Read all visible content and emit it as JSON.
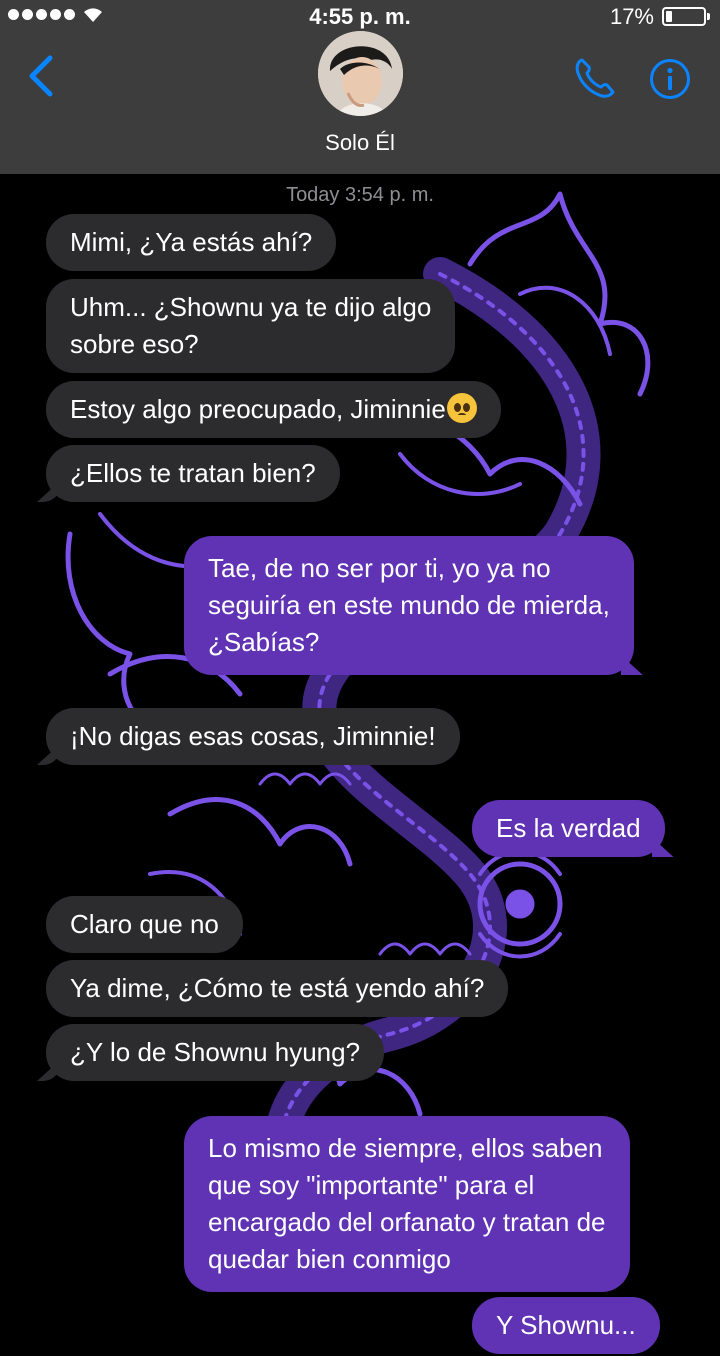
{
  "status_bar": {
    "time": "4:55 p. m.",
    "battery_percent": "17%",
    "battery_level": 0.17,
    "signal_dots": 5
  },
  "header": {
    "contact_name": "Solo Él",
    "back_icon": "chevron-left-icon",
    "call_icon": "phone-icon",
    "info_icon": "info-icon",
    "accent_color": "#0a84ff"
  },
  "conversation": {
    "timestamp": "Today 3:54 p. m.",
    "messages": [
      {
        "from": "them",
        "text": "Mimi, ¿Ya estás ahí?"
      },
      {
        "from": "them",
        "lines": [
          "Uhm... ¿Shownu ya te dijo algo",
          "sobre eso?"
        ]
      },
      {
        "from": "them",
        "text": "Estoy algo preocupado, Jiminnie",
        "emoji": "pleading-face-emoji"
      },
      {
        "from": "them",
        "text": "¿Ellos te tratan bien?"
      },
      {
        "from": "me",
        "lines": [
          "Tae, de no ser por ti, yo ya no",
          "seguiría en este mundo de mierda,",
          "¿Sabías?"
        ]
      },
      {
        "from": "them",
        "text": "¡No digas esas cosas, Jiminnie!"
      },
      {
        "from": "me",
        "text": "Es la verdad"
      },
      {
        "from": "them",
        "text": "Claro que no"
      },
      {
        "from": "them",
        "text": "Ya dime, ¿Cómo te está yendo ahí?"
      },
      {
        "from": "them",
        "text": "¿Y lo de Shownu hyung?"
      },
      {
        "from": "me",
        "lines": [
          "Lo mismo de siempre, ellos saben",
          "que soy \"importante\" para el",
          "encargado del orfanato y tratan de",
          "quedar bien conmigo"
        ]
      },
      {
        "from": "me",
        "text": "Y Shownu..."
      }
    ]
  },
  "colors": {
    "incoming_bubble": "#2c2c2e",
    "outgoing_bubble": "#5f33b3",
    "header_bg": "#3d3d3d",
    "background_art": "#7b52e8"
  }
}
